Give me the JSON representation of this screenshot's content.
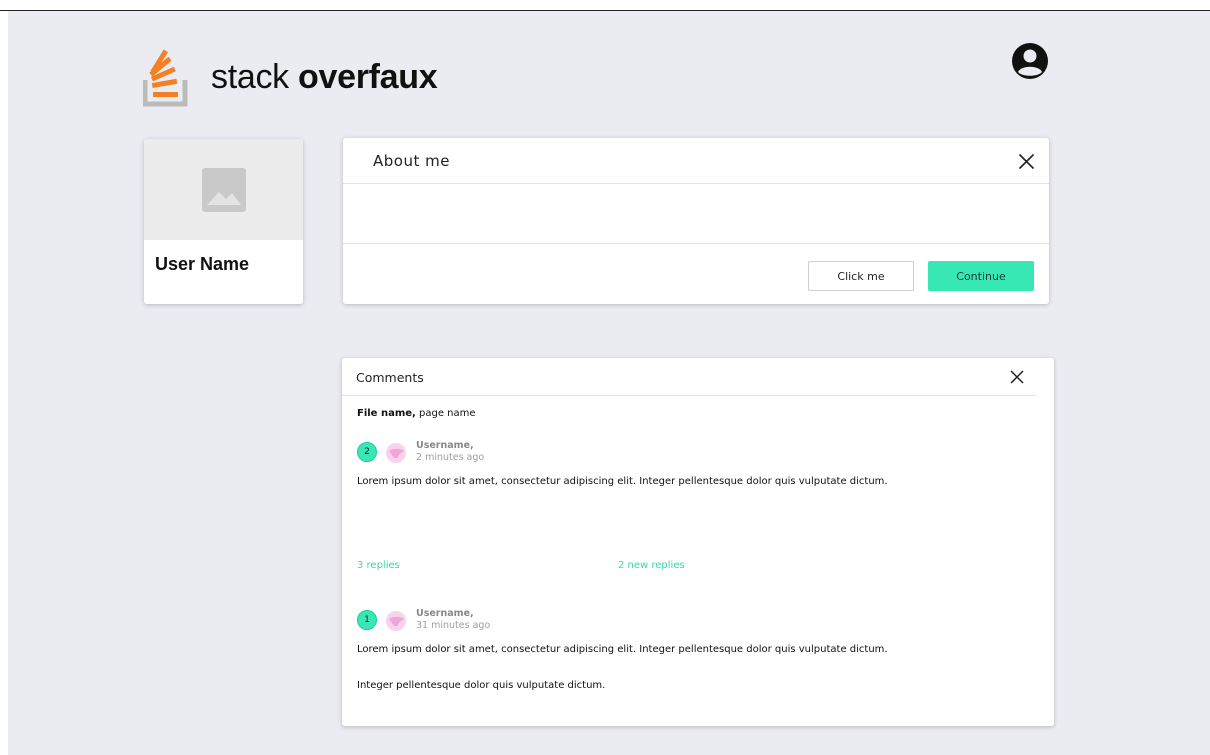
{
  "brand": {
    "name_light": "stack",
    "name_bold": "overfaux"
  },
  "header": {
    "account_icon": "user-circle-icon"
  },
  "profile": {
    "name": "User Name",
    "photo_icon": "image-placeholder-icon"
  },
  "about": {
    "title": "About me",
    "close_icon": "close-icon",
    "secondary_button": "Click me",
    "primary_button": "Continue"
  },
  "comments": {
    "title": "Comments",
    "close_icon": "close-icon",
    "file_name": "File name,",
    "page_name": " page name",
    "items": [
      {
        "badge": "2",
        "username": "Username,",
        "time": "2 minutes ago",
        "text": "Lorem ipsum dolor sit amet, consectetur adipiscing elit. Integer pellentesque dolor quis vulputate dictum.",
        "replies": "3 replies",
        "new_replies": "2 new replies"
      },
      {
        "badge": "1",
        "username": "Username,",
        "time": "31 minutes ago",
        "text": "Lorem ipsum dolor sit amet, consectetur adipiscing elit. Integer pellentesque dolor quis vulputate dictum.",
        "text2": "Integer pellentesque dolor quis vulputate dictum."
      }
    ]
  },
  "colors": {
    "background": "#ebebf2",
    "accent": "#37e8b5",
    "link": "#37d6b0",
    "logo_orange": "#f48024",
    "logo_gray": "#bcbbbb"
  }
}
